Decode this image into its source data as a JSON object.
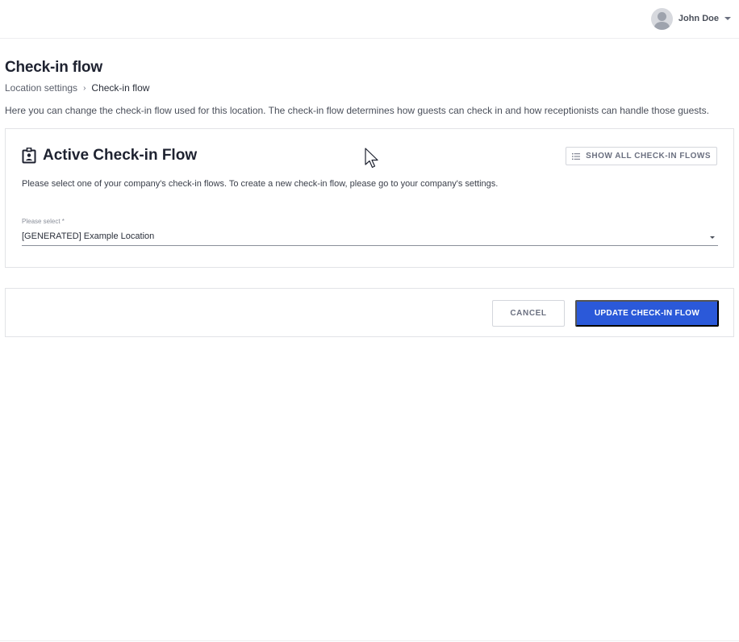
{
  "header": {
    "user_name": "John Doe",
    "avatar_icon": "user-avatar-icon",
    "menu_icon": "caret-down-icon"
  },
  "page": {
    "title": "Check-in flow",
    "breadcrumb": {
      "parent": "Location settings",
      "separator": "›",
      "current": "Check-in flow"
    },
    "description": "Here you can change the check-in flow used for this location. The check-in flow determines how guests can check in and how receptionists can handle those guests."
  },
  "card": {
    "icon": "badge-icon",
    "title": "Active Check-in Flow",
    "show_all_button": "SHOW ALL CHECK-IN FLOWS",
    "show_all_icon": "list-icon",
    "text": "Please select one of your company's check-in flows. To create a new check-in flow, please go to your company's settings.",
    "select": {
      "label": "Please select *",
      "value": "[GENERATED] Example Location",
      "arrow_icon": "dropdown-arrow-icon"
    }
  },
  "actions": {
    "cancel": "CANCEL",
    "submit": "UPDATE CHECK-IN FLOW"
  },
  "colors": {
    "primary": "#2b59d9",
    "text": "#1e2230",
    "border": "#e2e3e7"
  }
}
